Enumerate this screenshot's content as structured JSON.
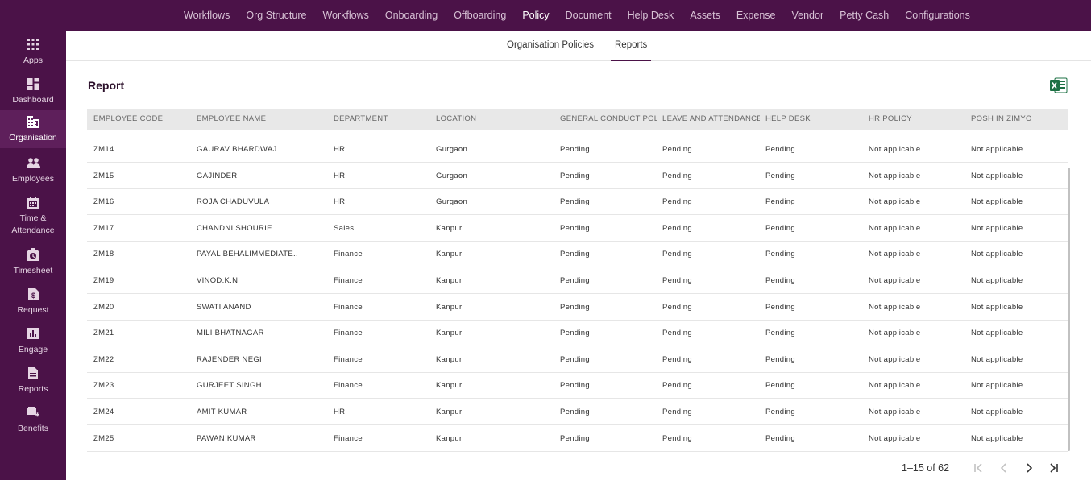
{
  "top_nav": [
    "Workflows",
    "Org Structure",
    "Workflows",
    "Onboarding",
    "Offboarding",
    "Policy",
    "Document",
    "Help Desk",
    "Assets",
    "Expense",
    "Vendor",
    "Petty Cash",
    "Configurations"
  ],
  "top_nav_active": "Policy",
  "sidebar": {
    "apps": "Apps",
    "dashboard": "Dashboard",
    "organisation": "Organisation",
    "employees": "Employees",
    "time_line1": "Time &",
    "time_line2": "Attendance",
    "timesheet": "Timesheet",
    "request": "Request",
    "engage": "Engage",
    "reports": "Reports",
    "benefits": "Benefits"
  },
  "subtabs": {
    "policies": "Organisation Policies",
    "reports": "Reports"
  },
  "page": {
    "title": "Report",
    "excel_icon": "excel-icon"
  },
  "table": {
    "columns": {
      "code": "EMPLOYEE CODE",
      "name": "EMPLOYEE NAME",
      "dept": "DEPARTMENT",
      "loc": "LOCATION",
      "gcp": "GENERAL CONDUCT POL",
      "laa": "LEAVE AND ATTENDANCE",
      "hd": "HELP DESK",
      "hrp": "HR POLICY",
      "posh": "POSH IN ZIMYO"
    },
    "rows": [
      [
        "ZM14",
        "GAURAV BHARDWAJ",
        "HR",
        "Gurgaon",
        "Pending",
        "Pending",
        "Pending",
        "Not applicable",
        "Not applicable"
      ],
      [
        "ZM15",
        "GAJINDER",
        "HR",
        "Gurgaon",
        "Pending",
        "Pending",
        "Pending",
        "Not applicable",
        "Not applicable"
      ],
      [
        "ZM16",
        "ROJA CHADUVULA",
        "HR",
        "Gurgaon",
        "Pending",
        "Pending",
        "Pending",
        "Not applicable",
        "Not applicable"
      ],
      [
        "ZM17",
        "CHANDNI SHOURIE",
        "Sales",
        "Kanpur",
        "Pending",
        "Pending",
        "Pending",
        "Not applicable",
        "Not applicable"
      ],
      [
        "ZM18",
        "PAYAL BEHALIMMEDIATE..",
        "Finance",
        "Kanpur",
        "Pending",
        "Pending",
        "Pending",
        "Not applicable",
        "Not applicable"
      ],
      [
        "ZM19",
        "VINOD.K.N",
        "Finance",
        "Kanpur",
        "Pending",
        "Pending",
        "Pending",
        "Not applicable",
        "Not applicable"
      ],
      [
        "ZM20",
        "SWATI ANAND",
        "Finance",
        "Kanpur",
        "Pending",
        "Pending",
        "Pending",
        "Not applicable",
        "Not applicable"
      ],
      [
        "ZM21",
        "MILI BHATNAGAR",
        "Finance",
        "Kanpur",
        "Pending",
        "Pending",
        "Pending",
        "Not applicable",
        "Not applicable"
      ],
      [
        "ZM22",
        "RAJENDER NEGI",
        "Finance",
        "Kanpur",
        "Pending",
        "Pending",
        "Pending",
        "Not applicable",
        "Not applicable"
      ],
      [
        "ZM23",
        "GURJEET SINGH",
        "Finance",
        "Kanpur",
        "Pending",
        "Pending",
        "Pending",
        "Not applicable",
        "Not applicable"
      ],
      [
        "ZM24",
        "AMIT KUMAR",
        "HR",
        "Kanpur",
        "Pending",
        "Pending",
        "Pending",
        "Not applicable",
        "Not applicable"
      ],
      [
        "ZM25",
        "PAWAN KUMAR",
        "Finance",
        "Kanpur",
        "Pending",
        "Pending",
        "Pending",
        "Not applicable",
        "Not applicable"
      ]
    ]
  },
  "pagination": {
    "range": "1–15 of 62"
  },
  "colors": {
    "brand": "#4b1248",
    "excel_green": "#1e7145"
  }
}
